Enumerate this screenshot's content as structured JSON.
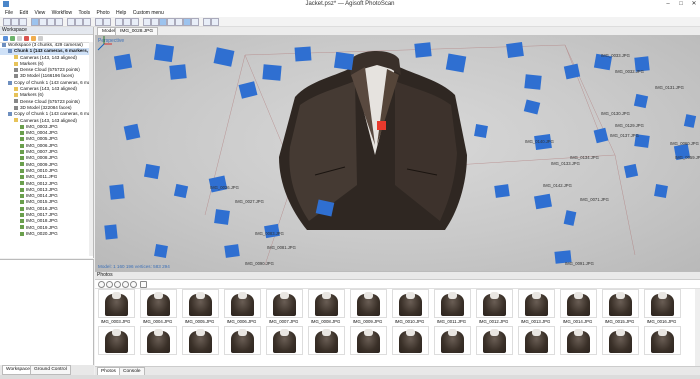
{
  "window": {
    "title": "Jacket.psz* — Agisoft PhotoScan",
    "minimize": "–",
    "maximize": "□",
    "close": "✕"
  },
  "menu": [
    "File",
    "Edit",
    "View",
    "Workflow",
    "Tools",
    "Photo",
    "Help",
    "Custom menu"
  ],
  "workspace": {
    "title": "Workspace",
    "tree": [
      {
        "label": "Workspace (3 chunks, 429 cameras)",
        "icon": "chunk",
        "indent": 0
      },
      {
        "label": "Chunk 1 (143 cameras, 6 markers, ...",
        "icon": "chunk",
        "indent": 1,
        "bold": true
      },
      {
        "label": "Cameras (143, 143 aligned)",
        "icon": "folder",
        "indent": 2
      },
      {
        "label": "Markers (6)",
        "icon": "folder",
        "indent": 2
      },
      {
        "label": "Dense Cloud (575723 points)",
        "icon": "obj",
        "indent": 2
      },
      {
        "label": "3D Model (1166196 faces)",
        "icon": "obj",
        "indent": 2
      },
      {
        "label": "Copy of Chunk 1 (143 cameras, 6 ma...",
        "icon": "chunk",
        "indent": 1
      },
      {
        "label": "Cameras (143, 143 aligned)",
        "icon": "folder",
        "indent": 2
      },
      {
        "label": "Markers (6)",
        "icon": "folder",
        "indent": 2
      },
      {
        "label": "Dense Cloud (575723 points)",
        "icon": "obj",
        "indent": 2
      },
      {
        "label": "3D Model (322084 faces)",
        "icon": "obj",
        "indent": 2
      },
      {
        "label": "Copy of Chunk 1 (143 cameras, 6 ma...",
        "icon": "chunk",
        "indent": 1
      },
      {
        "label": "Cameras (143, 143 aligned)",
        "icon": "folder",
        "indent": 2
      },
      {
        "label": "IMG_0003.JPG",
        "icon": "cam",
        "indent": 3
      },
      {
        "label": "IMG_0004.JPG",
        "icon": "cam",
        "indent": 3
      },
      {
        "label": "IMG_0005.JPG",
        "icon": "cam",
        "indent": 3
      },
      {
        "label": "IMG_0006.JPG",
        "icon": "cam",
        "indent": 3
      },
      {
        "label": "IMG_0007.JPG",
        "icon": "cam",
        "indent": 3
      },
      {
        "label": "IMG_0008.JPG",
        "icon": "cam",
        "indent": 3
      },
      {
        "label": "IMG_0009.JPG",
        "icon": "cam",
        "indent": 3
      },
      {
        "label": "IMG_0010.JPG",
        "icon": "cam",
        "indent": 3
      },
      {
        "label": "IMG_0011.JPG",
        "icon": "cam",
        "indent": 3
      },
      {
        "label": "IMG_0012.JPG",
        "icon": "cam",
        "indent": 3
      },
      {
        "label": "IMG_0013.JPG",
        "icon": "cam",
        "indent": 3
      },
      {
        "label": "IMG_0014.JPG",
        "icon": "cam",
        "indent": 3
      },
      {
        "label": "IMG_0015.JPG",
        "icon": "cam",
        "indent": 3
      },
      {
        "label": "IMG_0016.JPG",
        "icon": "cam",
        "indent": 3
      },
      {
        "label": "IMG_0017.JPG",
        "icon": "cam",
        "indent": 3
      },
      {
        "label": "IMG_0018.JPG",
        "icon": "cam",
        "indent": 3
      },
      {
        "label": "IMG_0019.JPG",
        "icon": "cam",
        "indent": 3
      },
      {
        "label": "IMG_0020.JPG",
        "icon": "cam",
        "indent": 3
      }
    ],
    "tabs": [
      "Workspace",
      "Ground Control"
    ]
  },
  "model": {
    "tabs": [
      "Model",
      "IMG_0028.JPG"
    ],
    "view_label": "Perspective",
    "status": "Model: 1 160 196 vertices: 583 294",
    "camera_labels": [
      "IMG_0033.JPG",
      "IMG_0032.JPG",
      "IMG_0131.JPG",
      "IMG_0130.JPG",
      "IMG_0129.JPG",
      "IMG_0134.JPG",
      "IMG_0133.JPG",
      "IMG_0060.JPG",
      "IMG_0059.JPG",
      "IMG_0142.JPG",
      "IMG_0071.JPG",
      "IMG_0026.JPG",
      "IMG_0027.JPG",
      "IMG_0083.JPG",
      "IMG_0081.JPG",
      "IMG_0091.JPG",
      "IMG_0090.JPG",
      "IMG_0140.JPG",
      "IMG_0137.JPG"
    ],
    "axis_colors": {
      "x": "#d32f2f",
      "y": "#2e7d32",
      "z": "#1565c0"
    }
  },
  "photos": {
    "title": "Photos",
    "items": [
      "IMG_0003.JPG",
      "IMG_0004.JPG",
      "IMG_0005.JPG",
      "IMG_0006.JPG",
      "IMG_0007.JPG",
      "IMG_0008.JPG",
      "IMG_0009.JPG",
      "IMG_0010.JPG",
      "IMG_0011.JPG",
      "IMG_0012.JPG",
      "IMG_0013.JPG",
      "IMG_0014.JPG",
      "IMG_0015.JPG",
      "IMG_0016.JPG"
    ],
    "tabs": [
      "Photos",
      "Console"
    ]
  },
  "colors": {
    "camera_blue": "#2f6fd1",
    "marker_red": "#e8392c",
    "selection": "#cfe1f7"
  }
}
